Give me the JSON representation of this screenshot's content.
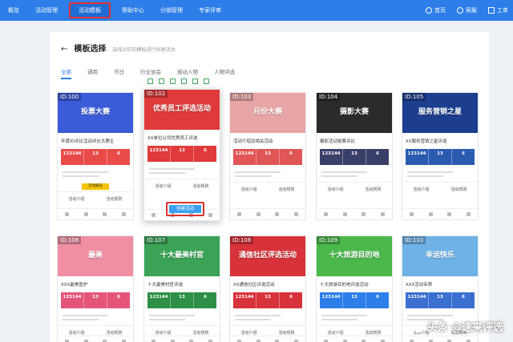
{
  "nav": {
    "items": [
      "概览",
      "活动管理",
      "活动模板",
      "帮助中心",
      "分销管理",
      "专家评审"
    ],
    "active_index": 2,
    "right": [
      "首页",
      "客服",
      "工单"
    ]
  },
  "panel": {
    "back": "←",
    "title": "模板选择",
    "subtitle": "选择对应的模板进行创建活动",
    "tabs": [
      "全部",
      "通用",
      "节日",
      "行业协会",
      "感动人物",
      "人物评选"
    ]
  },
  "cards": [
    {
      "id": "ID:100",
      "banner": "投票大赛",
      "name": "年度ID评比活动评比大赛主",
      "color": "#3b5bd8",
      "stat": "#e94b4b",
      "links": [
        "活动介绍",
        "活动规则"
      ]
    },
    {
      "id": "ID:102",
      "banner": "优秀员工评选活动",
      "name": "XX单位公司优秀员工评选",
      "color": "#e03a3a",
      "stat": "#e03a3a",
      "links": [
        "活动介绍",
        "活动规则"
      ]
    },
    {
      "id": "ID:103",
      "banner": "月份大赛",
      "name": "活动介绍及相关活动",
      "color": "#e8a5a5",
      "stat": "#e05555",
      "links": [
        "活动介绍",
        "活动规则"
      ]
    },
    {
      "id": "ID:104",
      "banner": "摄影大赛",
      "name": "摄影活动投票评比",
      "color": "#2b2b2b",
      "stat": "#3a3f6a",
      "links": [
        "活动介绍",
        "活动规则"
      ]
    },
    {
      "id": "ID:105",
      "banner": "服务营销之星",
      "name": "XX服务营销之星评选",
      "color": "#1d3e8f",
      "stat": "#2a5bb0",
      "links": [
        "活动介绍",
        "活动规则"
      ]
    },
    {
      "id": "ID:106",
      "banner": "最美",
      "name": "XXX最美医护",
      "color": "#f08fa3",
      "stat": "#e5557a",
      "links": [
        "活动介绍",
        "活动规则"
      ]
    },
    {
      "id": "ID:107",
      "banner": "十大最美村官",
      "name": "十大最美村官评选",
      "color": "#3aa356",
      "stat": "#2e8f47",
      "links": [
        "活动介绍",
        "活动规则"
      ]
    },
    {
      "id": "ID:108",
      "banner": "通信社区评选活动",
      "name": "XX通信社区评选活动",
      "color": "#d8323a",
      "stat": "#d8323a",
      "links": [
        "活动介绍",
        "活动规则"
      ]
    },
    {
      "id": "ID:109",
      "banner": "十大旅游目的地",
      "name": "十大旅游目的地评选活动",
      "color": "#4ab84a",
      "stat": "#2d7ee8",
      "links": [
        "活动介绍",
        "活动规则"
      ]
    },
    {
      "id": "ID:110",
      "banner": "幸运快乐",
      "name": "XXX活动名称",
      "color": "#6fb2e8",
      "stat": "#3b6fd0",
      "links": [
        "活动介绍",
        "活动规则"
      ]
    }
  ],
  "stats_labels": [
    "123144",
    "13",
    "6"
  ],
  "create_button": "创建活动",
  "yellow_button": "活动报名",
  "watermark": "头条 @速来评选"
}
